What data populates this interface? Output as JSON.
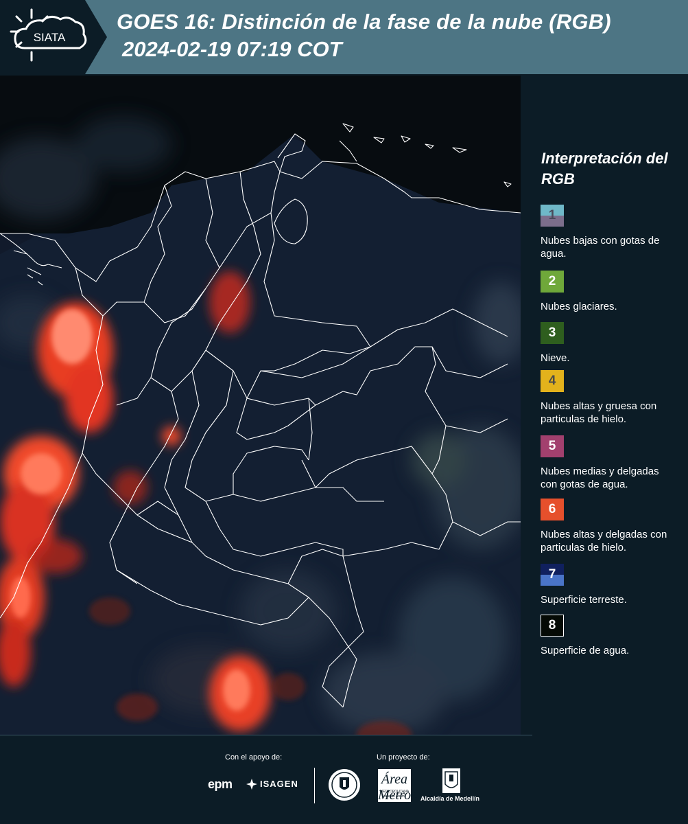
{
  "header": {
    "logo_text": "SIATA",
    "title_line1": "GOES 16: Distinción de la fase de la nube (RGB)",
    "title_line2": "2024-02-19 07:19 COT",
    "background": "#4d7584"
  },
  "legend": {
    "title": "Interpretación del RGB",
    "items": [
      {
        "number": "1",
        "label": "Nubes bajas con gotas de agua.",
        "color_top": "#6fb8c8",
        "color_bottom": "#7c6e8c",
        "num_color": "#4a4a5a"
      },
      {
        "number": "2",
        "label": "Nubes glaciares.",
        "color_top": "#6fa83a",
        "color_bottom": "#6fa83a",
        "num_color": "#ffffff"
      },
      {
        "number": "3",
        "label": "Nieve.",
        "color_top": "#2e5e1e",
        "color_bottom": "#2e5e1e",
        "num_color": "#ffffff"
      },
      {
        "number": "4",
        "label": "Nubes altas y gruesa con particulas de hielo.",
        "color_top": "#e3b21c",
        "color_bottom": "#e3b21c",
        "num_color": "#4a4a4a"
      },
      {
        "number": "5",
        "label": "Nubes medias y delgadas con gotas de agua.",
        "color_top": "#a2406e",
        "color_bottom": "#a2406e",
        "num_color": "#ffffff"
      },
      {
        "number": "6",
        "label": "Nubes altas y delgadas con particulas de hielo.",
        "color_top": "#e6502c",
        "color_bottom": "#e6502c",
        "num_color": "#ffffff"
      },
      {
        "number": "7",
        "label": "Superficie terreste.",
        "color_top": "#10205e",
        "color_bottom": "#4a74c8",
        "num_color": "#ffffff"
      },
      {
        "number": "8",
        "label": "Superficie de agua.",
        "color_top": "#050a05",
        "color_bottom": "#050a05",
        "num_color": "#ffffff"
      }
    ]
  },
  "footer": {
    "support_label": "Con el apoyo de:",
    "project_label": "Un proyecto de:",
    "sponsor1": "epm",
    "sponsor2": "ISAGEN",
    "partner1": "Área Metropolitana",
    "partner1_sub": "METROPOLITANA",
    "partner1_sub2": "Valle de Aburrá",
    "partner2": "Alcaldía de Medellín"
  }
}
